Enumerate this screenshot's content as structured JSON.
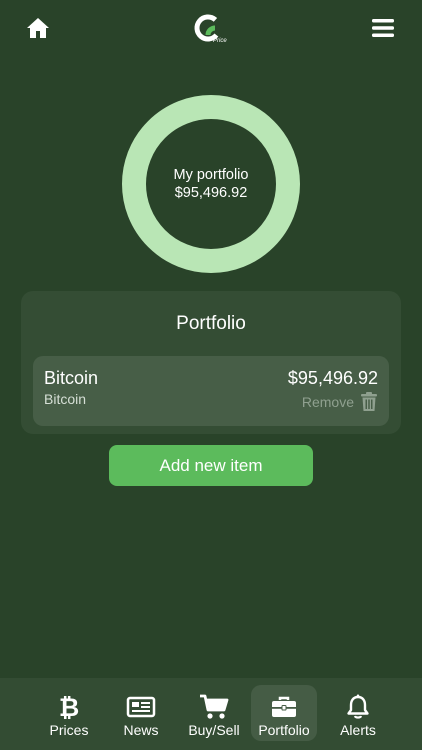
{
  "header": {
    "logo_text": "Price"
  },
  "summary": {
    "label": "My portfolio",
    "value": "$95,496.92",
    "ring_color": "#b9e6b5"
  },
  "portfolio": {
    "title": "Portfolio",
    "items": [
      {
        "name": "Bitcoin",
        "subtitle": "Bitcoin",
        "value": "$95,496.92",
        "remove_label": "Remove"
      }
    ]
  },
  "add_button": {
    "label": "Add new item"
  },
  "tabs": [
    {
      "label": "Prices",
      "icon": "bitcoin-icon",
      "active": false
    },
    {
      "label": "News",
      "icon": "newspaper-icon",
      "active": false
    },
    {
      "label": "Buy/Sell",
      "icon": "cart-icon",
      "active": false
    },
    {
      "label": "Portfolio",
      "icon": "briefcase-icon",
      "active": true
    },
    {
      "label": "Alerts",
      "icon": "bell-icon",
      "active": false
    }
  ],
  "colors": {
    "background": "#294329",
    "accent": "#5cbb5c"
  }
}
